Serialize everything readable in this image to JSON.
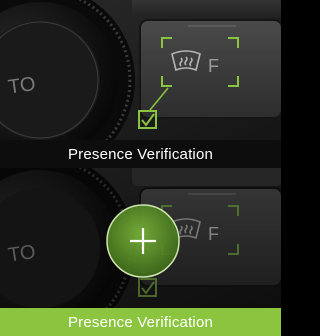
{
  "panels": [
    {
      "id": "top",
      "caption": "Presence Verification",
      "state": "detected",
      "accent_color": "#8bc53f",
      "bar_color": "#0d0d0d",
      "button_label": "F",
      "knob_label": "TO"
    },
    {
      "id": "bottom",
      "caption": "Presence Verification",
      "state": "pressed",
      "accent_color": "#8bc53f",
      "bar_color": "#8bc53f",
      "button_label": "F",
      "knob_label": "TO"
    }
  ],
  "icons": {
    "detection_frame": "corner-brackets",
    "confirmation": "checkmark-icon",
    "defrost": "defrost-windshield-icon",
    "touch": "plus-icon"
  }
}
